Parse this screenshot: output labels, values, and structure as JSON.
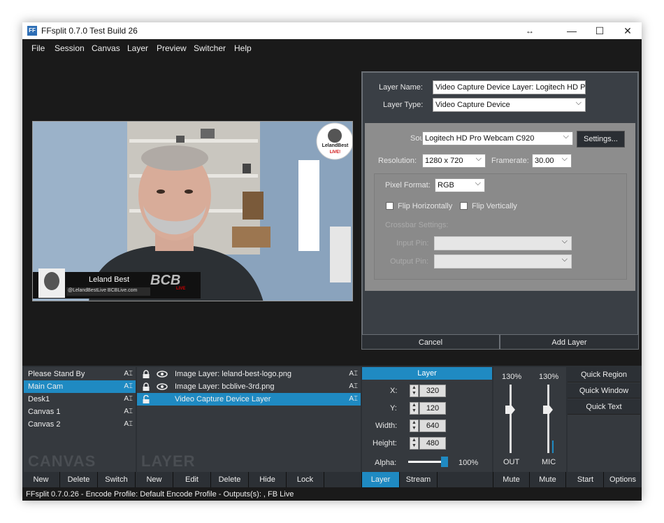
{
  "window": {
    "icon_text": "FF",
    "title": "FFsplit 0.7.0 Test Build 26",
    "resize_glyph": "↔",
    "minimize_glyph": "—",
    "maximize_glyph": "☐",
    "close_glyph": "✕"
  },
  "menu": [
    "File",
    "Session",
    "Canvas",
    "Layer",
    "Preview",
    "Switcher",
    "Help"
  ],
  "preview": {
    "logo_top": "LelandBest",
    "logo_bottom": "LIVE!",
    "name": "Leland Best",
    "handles": "@LelandBestLive  BCBLive.com",
    "brand": "BCB",
    "brand_sub": "LIVE"
  },
  "layer_panel": {
    "layer_name_label": "Layer Name:",
    "layer_name_value": "Video Capture Device Layer: Logitech HD Pro",
    "layer_type_label": "Layer Type:",
    "layer_type_value": "Video Capture Device",
    "source_label": "Source:",
    "source_value": "Logitech HD Pro Webcam C920",
    "settings_button": "Settings...",
    "resolution_label": "Resolution:",
    "resolution_value": "1280 x 720",
    "framerate_label": "Framerate:",
    "framerate_value": "30.00",
    "pixel_format_label": "Pixel Format:",
    "pixel_format_value": "RGB",
    "flip_h_label": "Flip Horizontally",
    "flip_v_label": "Flip Vertically",
    "crossbar_label": "Crossbar Settings:",
    "input_pin_label": "Input Pin:",
    "output_pin_label": "Output Pin:",
    "cancel_button": "Cancel",
    "add_layer_button": "Add Layer"
  },
  "canvases": [
    {
      "label": "Please Stand By",
      "active": false
    },
    {
      "label": "Main Cam",
      "active": true
    },
    {
      "label": "Desk1",
      "active": false
    },
    {
      "label": "Canvas 1",
      "active": false
    },
    {
      "label": "Canvas 2",
      "active": false
    }
  ],
  "canvas_watermark": "CANVAS",
  "layers": [
    {
      "label": "Image Layer: leland-best-logo.png",
      "active": false,
      "visible": true
    },
    {
      "label": "Image Layer: bcblive-3rd.png",
      "active": false,
      "visible": true
    },
    {
      "label": "Video Capture Device Layer",
      "active": true,
      "visible": false
    }
  ],
  "layer_watermark": "LAYER",
  "rename_glyph": "A⌶",
  "props": {
    "header": "Layer",
    "x_label": "X:",
    "x": "320",
    "y_label": "Y:",
    "y": "120",
    "width_label": "Width:",
    "width": "640",
    "height_label": "Height:",
    "height": "480",
    "alpha_label": "Alpha:",
    "alpha": "100%",
    "alpha_fraction": 1.0
  },
  "audio": {
    "out_pct": "130%",
    "mic_pct": "130%",
    "out_label": "OUT",
    "mic_label": "MIC"
  },
  "quick": [
    "Quick Region",
    "Quick Window",
    "Quick Text"
  ],
  "buttons": {
    "canvas": [
      "New",
      "Delete",
      "Switch"
    ],
    "layer": [
      "New",
      "Edit",
      "Delete",
      "Hide",
      "Lock"
    ],
    "tabs": [
      "Layer",
      "Stream"
    ],
    "mute_out": "Mute",
    "mute_mic": "Mute",
    "start": "Start",
    "options": "Options"
  },
  "status": "FFsplit 0.7.0.26 - Encode Profile: Default Encode Profile - Outputs(s): , FB Live"
}
